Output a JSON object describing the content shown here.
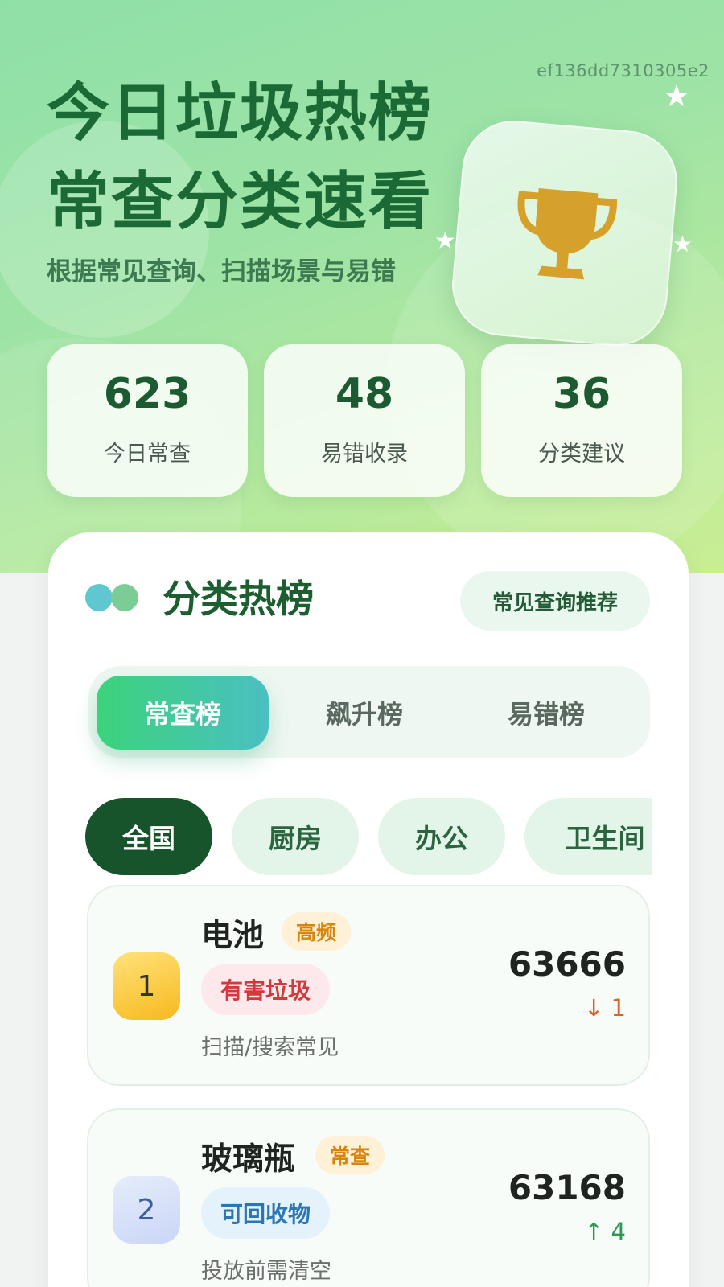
{
  "hero": {
    "hash": "ef136dd7310305e2",
    "title_line1": "今日垃圾热榜",
    "title_line2": "常查分类速看",
    "subtitle": "根据常见查询、扫描场景与易错"
  },
  "stats": [
    {
      "value": "623",
      "label": "今日常查"
    },
    {
      "value": "48",
      "label": "易错收录"
    },
    {
      "value": "36",
      "label": "分类建议"
    }
  ],
  "panel": {
    "title": "分类热榜",
    "action_label": "常见查询推荐",
    "tabs": [
      {
        "label": "常查榜",
        "active": true
      },
      {
        "label": "飙升榜",
        "active": false
      },
      {
        "label": "易错榜",
        "active": false
      }
    ],
    "chips": [
      {
        "label": "全国",
        "active": true
      },
      {
        "label": "厨房",
        "active": false
      },
      {
        "label": "办公",
        "active": false
      },
      {
        "label": "卫生间",
        "active": false
      }
    ],
    "items": [
      {
        "rank": "1",
        "name": "电池",
        "tag": "高频",
        "category": "有害垃圾",
        "note": "扫描/搜索常见",
        "count": "63666",
        "trend": "↓ 1",
        "trend_dir": "down"
      },
      {
        "rank": "2",
        "name": "玻璃瓶",
        "tag": "常查",
        "category": "可回收物",
        "note": "投放前需清空",
        "count": "63168",
        "trend": "↑ 4",
        "trend_dir": "up"
      }
    ]
  },
  "colors": {
    "brand_green": "#1b6a35",
    "accent_gradient_start": "#3bd37b",
    "accent_gradient_end": "#4bbfc2",
    "trophy_gold": "#d6a12a",
    "hazard_red": "#d03a3a",
    "recycle_blue": "#2c77b3"
  },
  "icons": [
    "trophy-icon",
    "star-icon"
  ]
}
